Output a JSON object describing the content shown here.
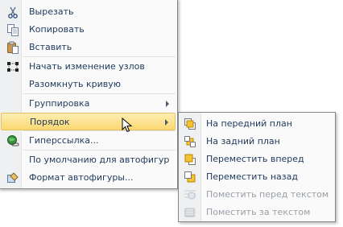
{
  "menu": {
    "items": [
      {
        "label": "Вырезать",
        "icon": "scissors-icon"
      },
      {
        "label": "Копировать",
        "icon": "copy-icon"
      },
      {
        "label": "Вставить",
        "icon": "paste-icon"
      },
      {
        "label": "Начать изменение узлов",
        "icon": "edit-points-icon"
      },
      {
        "label": "Разомкнуть кривую"
      },
      {
        "label": "Группировка",
        "submenu": true
      },
      {
        "label": "Порядок",
        "submenu": true,
        "highlighted": true
      },
      {
        "label": "Гиперссылка...",
        "icon": "hyperlink-globe-icon"
      },
      {
        "label": "По умолчанию для автофигур"
      },
      {
        "label": "Формат автофигуры...",
        "icon": "format-shape-icon"
      }
    ]
  },
  "submenu": {
    "items": [
      {
        "label": "На передний план",
        "icon": "bring-to-front-icon"
      },
      {
        "label": "На задний план",
        "icon": "send-to-back-icon"
      },
      {
        "label": "Переместить вперед",
        "icon": "bring-forward-icon"
      },
      {
        "label": "Переместить назад",
        "icon": "send-backward-icon"
      },
      {
        "label": "Поместить перед текстом",
        "icon": "in-front-of-text-icon",
        "disabled": true
      },
      {
        "label": "Поместить за текстом",
        "icon": "behind-text-icon",
        "disabled": true
      }
    ]
  },
  "colors": {
    "menu_text": "#1e395b",
    "highlight_top": "#fdeeb3",
    "highlight_bottom": "#fbd870",
    "disabled_text": "#9aa0a8"
  }
}
